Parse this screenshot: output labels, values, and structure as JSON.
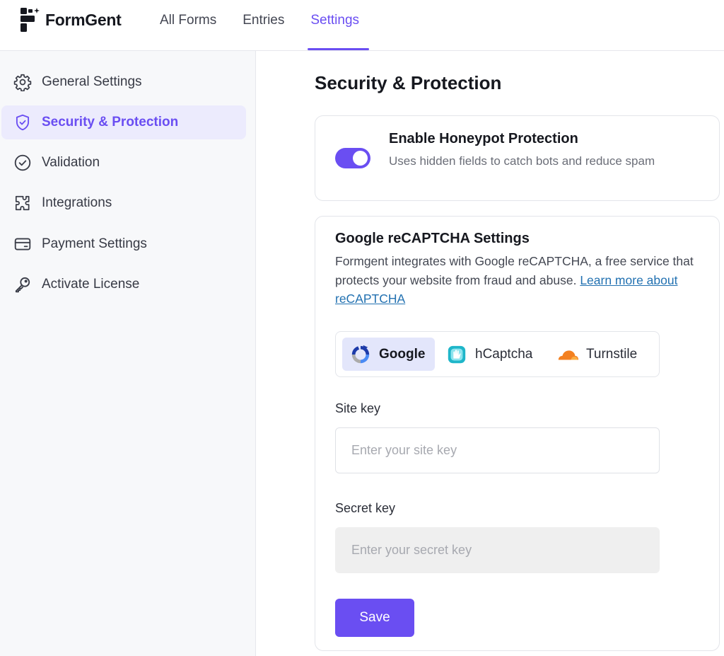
{
  "brand": {
    "name": "FormGent",
    "accent": "#6a4ef2"
  },
  "nav": {
    "items": [
      {
        "label": "All Forms"
      },
      {
        "label": "Entries"
      },
      {
        "label": "Settings",
        "active": true
      }
    ]
  },
  "sidebar": {
    "items": [
      {
        "label": "General Settings",
        "icon": "gear-icon"
      },
      {
        "label": "Security & Protection",
        "icon": "shield-check-icon",
        "active": true
      },
      {
        "label": "Validation",
        "icon": "check-circle-icon"
      },
      {
        "label": "Integrations",
        "icon": "puzzle-icon"
      },
      {
        "label": "Payment Settings",
        "icon": "credit-card-icon"
      },
      {
        "label": "Activate License",
        "icon": "key-icon"
      }
    ]
  },
  "page": {
    "title": "Security & Protection"
  },
  "honeypot": {
    "title": "Enable Honeypot Protection",
    "description": "Uses hidden fields to catch bots and reduce spam",
    "enabled": true
  },
  "recaptcha": {
    "title": "Google reCAPTCHA Settings",
    "description": "Formgent integrates with Google reCAPTCHA, a free service that protects your website from fraud and abuse.",
    "link_text": "Learn more about reCAPTCHA",
    "providers": [
      {
        "label": "Google",
        "icon": "recaptcha-icon",
        "active": true
      },
      {
        "label": "hCaptcha",
        "icon": "hcaptcha-icon"
      },
      {
        "label": "Turnstile",
        "icon": "cloudflare-icon"
      }
    ],
    "site_key": {
      "label": "Site key",
      "placeholder": "Enter your site key",
      "value": ""
    },
    "secret_key": {
      "label": "Secret key",
      "placeholder": "Enter your secret key",
      "value": ""
    },
    "save_label": "Save"
  }
}
